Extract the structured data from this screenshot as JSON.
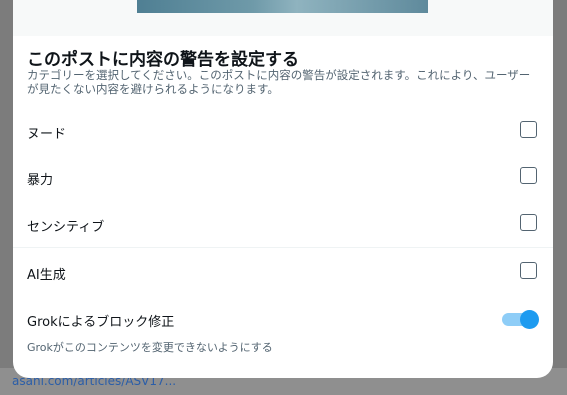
{
  "modal": {
    "title": "このポストに内容の警告を設定する",
    "description": "カテゴリーを選択してください。このポストに内容の警告が設定されます。これにより、ユーザーが見たくない内容を避けられるようになります。"
  },
  "options": [
    {
      "label": "ヌード",
      "checked": false
    },
    {
      "label": "暴力",
      "checked": false
    },
    {
      "label": "センシティブ",
      "checked": false
    },
    {
      "label": "AI生成",
      "checked": false
    }
  ],
  "grok": {
    "label": "Grokによるブロック修正",
    "sub": "Grokがこのコンテンツを変更できないようにする",
    "enabled": true
  },
  "backdrop": {
    "link": "asahi.com/articles/ASV17..."
  },
  "colors": {
    "accent": "#1d9bf0",
    "toggle_track": "#8ecdf7"
  }
}
